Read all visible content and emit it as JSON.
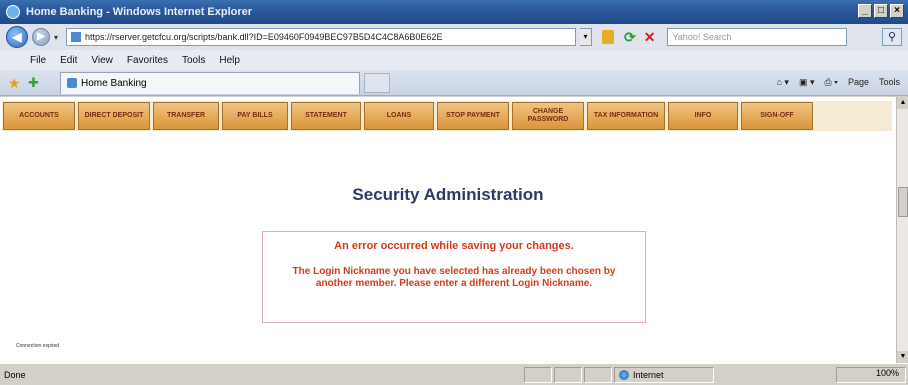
{
  "window": {
    "title": "Home Banking - Windows Internet Explorer"
  },
  "address": {
    "url": "https://rserver.getcfcu.org/scripts/bank.dll?ID=E09460F0949BEC97B5D4C4C8A6B0E62E",
    "search_placeholder": "Yahoo! Search"
  },
  "menu": [
    "File",
    "Edit",
    "View",
    "Favorites",
    "Tools",
    "Help"
  ],
  "tab": {
    "label": "Home Banking"
  },
  "command_bar": [
    "Page",
    "Tools"
  ],
  "bank_nav": [
    {
      "label": "ACCOUNTS",
      "w": 72
    },
    {
      "label": "DIRECT DEPOSIT",
      "w": 72
    },
    {
      "label": "TRANSFER",
      "w": 66
    },
    {
      "label": "PAY BILLS",
      "w": 66
    },
    {
      "label": "STATEMENT",
      "w": 70
    },
    {
      "label": "LOANS",
      "w": 70
    },
    {
      "label": "STOP PAYMENT",
      "w": 72
    },
    {
      "label": "CHANGE PASSWORD",
      "w": 72
    },
    {
      "label": "TAX INFORMATION",
      "w": 78
    },
    {
      "label": "INFO",
      "w": 70
    },
    {
      "label": "SIGN-OFF",
      "w": 72
    }
  ],
  "heading": "Security Administration",
  "error": {
    "title": "An error occurred while saving your changes.",
    "message": "The Login Nickname you have selected has already been chosen by another member. Please enter a different Login Nickname."
  },
  "footnote": "Connection expired",
  "status": {
    "text": "Done",
    "zone": "Internet",
    "zoom": "100%"
  }
}
